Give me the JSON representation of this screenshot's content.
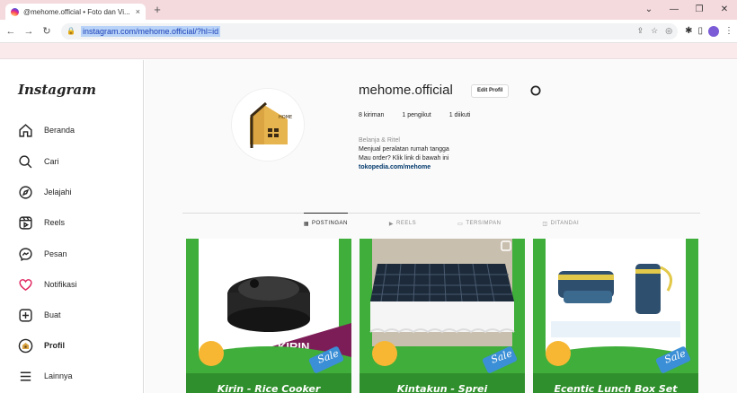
{
  "browser": {
    "tab_title": "@mehome.official • Foto dan Vi...",
    "tab_close": "×",
    "new_tab": "+",
    "url": "instagram.com/mehome.official/?hl=id"
  },
  "sidebar": {
    "logo": "Instagram",
    "items": [
      {
        "label": "Beranda",
        "icon": "home-icon"
      },
      {
        "label": "Cari",
        "icon": "search-icon"
      },
      {
        "label": "Jelajahi",
        "icon": "compass-icon"
      },
      {
        "label": "Reels",
        "icon": "reels-icon"
      },
      {
        "label": "Pesan",
        "icon": "messenger-icon"
      },
      {
        "label": "Notifikasi",
        "icon": "heart-icon"
      },
      {
        "label": "Buat",
        "icon": "create-icon"
      },
      {
        "label": "Profil",
        "icon": "profile-avatar-icon"
      },
      {
        "label": "Lainnya",
        "icon": "menu-icon"
      }
    ]
  },
  "profile": {
    "username": "mehome.official",
    "edit_button": "Edit Profil",
    "avatar_text": "HOME",
    "stats": [
      "8 kiriman",
      "1 pengikut",
      "1 diikuti"
    ],
    "category": "Belanja & Ritel",
    "bio_lines": [
      "Menjual peralatan rumah tangga",
      "Mau order? Klik link di bawah ini"
    ],
    "link": "tokopedia.com/mehome"
  },
  "tabs": [
    {
      "label": "POSTINGAN",
      "icon": "grid-icon"
    },
    {
      "label": "REELS",
      "icon": "reels-icon"
    },
    {
      "label": "TERSIMPAN",
      "icon": "bookmark-icon"
    },
    {
      "label": "DITANDAI",
      "icon": "tag-icon"
    }
  ],
  "posts": [
    {
      "title": "Kirin - Rice Cooker",
      "brand": "KIRIN",
      "badge": "Sale"
    },
    {
      "title": "Kintakun - Sprei",
      "badge": "Sale"
    },
    {
      "title": "Ecentic Lunch Box Set",
      "badge": "Sale"
    }
  ],
  "colors": {
    "post_green": "#3fae3a",
    "post_yellow": "#f7b733",
    "kirin_purple": "#7d1d57",
    "badge_blue": "#3b8fd6"
  }
}
